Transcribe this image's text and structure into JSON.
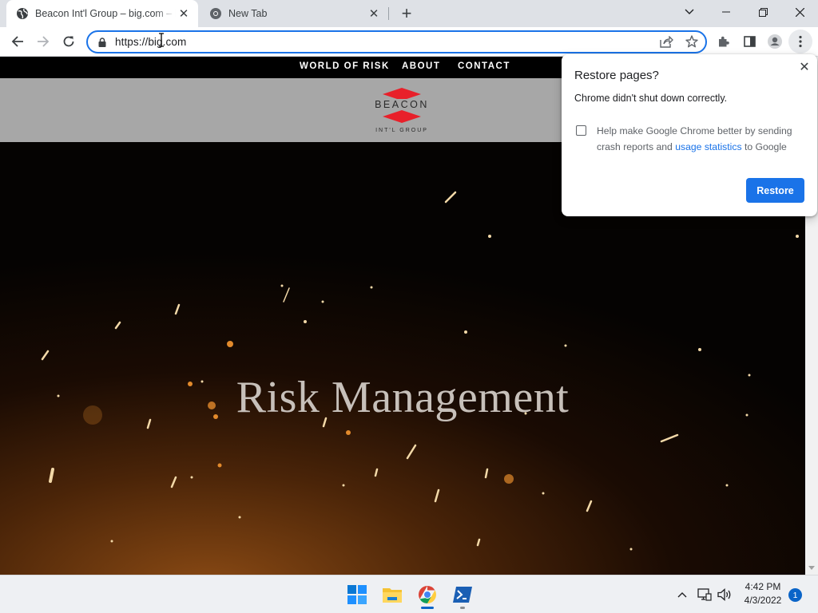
{
  "browser": {
    "tabs": [
      {
        "title": "Beacon Int'l Group – big.com – h",
        "active": true
      },
      {
        "title": "New Tab",
        "active": false
      }
    ],
    "address_bar": {
      "url": "https://big.com"
    },
    "icons": {
      "back": "arrow-left-icon",
      "forward": "arrow-right-icon",
      "reload": "reload-icon",
      "share": "share-icon",
      "bookmark": "star-icon",
      "extensions": "puzzle-icon",
      "sidepanel": "sidepanel-icon",
      "profile": "profile-icon",
      "menu": "kebab-menu-icon"
    }
  },
  "site": {
    "nav": [
      "WORLD OF RISK",
      "ABOUT",
      "CONTACT"
    ],
    "logo": {
      "name": "BEACON",
      "sub": "INT'L GROUP"
    },
    "hero_title": "Risk Management",
    "colors": {
      "logo_red": "#e8202a",
      "header_bg": "#a7a7a7"
    }
  },
  "restore_dialog": {
    "title": "Restore pages?",
    "message": "Chrome didn't shut down correctly.",
    "checkbox_text_1": "Help make Google Chrome better by sending crash reports and ",
    "checkbox_link": "usage statistics",
    "checkbox_text_2": " to Google",
    "checkbox_checked": false,
    "button": "Restore",
    "accent": "#1a73e8"
  },
  "taskbar": {
    "apps": [
      "start-icon",
      "file-explorer-icon",
      "chrome-icon",
      "powershell-icon"
    ],
    "time": "4:42 PM",
    "date": "4/3/2022",
    "notifications": "1"
  }
}
